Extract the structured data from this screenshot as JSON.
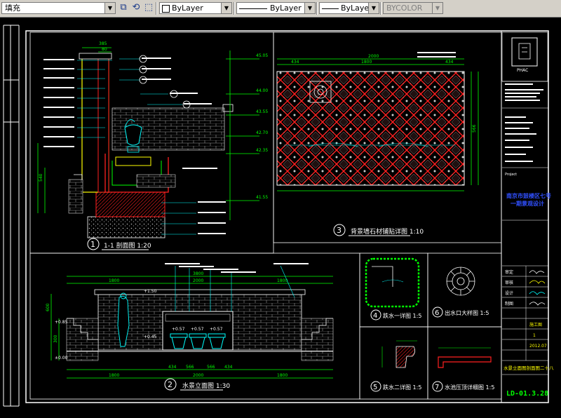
{
  "toolbar": {
    "hatch_layer": "填充",
    "color": "ByLayer",
    "linetype": "ByLayer",
    "lineweight": "ByLayer",
    "plotstyle": "BYCOLOR"
  },
  "drawing": {
    "view1_title": "1-1 剖面图 1:20",
    "view2_title": "水景立面图 1:30",
    "view3_title": "背景墙石材铺贴详图 1:10",
    "view4_title": "跌水一详图 1:5",
    "view5_title": "跌水二详图 1:5",
    "view6_title": "出水口大样图 1:5",
    "view7_title": "水池压顶详细图 1:5",
    "num1": "1",
    "num2": "2",
    "num3": "3",
    "num4": "4",
    "num5": "5",
    "num6": "6",
    "num7": "7",
    "dims": {
      "d1800a": "1800",
      "d1800b": "1800",
      "d2000": "2000",
      "d1800c": "1800",
      "d434a": "434",
      "d566a": "566",
      "d566b": "566",
      "d434b": "434",
      "d3800": "3800",
      "d1800d": "1800",
      "d2000b": "2000",
      "d1800e": "1800",
      "d434c": "434",
      "d566c": "566",
      "d566d": "566",
      "d434d": "434",
      "lv257a": "+0.57",
      "lv257b": "+0.57",
      "lv257c": "+0.57",
      "lv085": "+0.85",
      "lv045": "+0.45",
      "lv150": "+1.50",
      "lv000": "±0.00",
      "d300": "300",
      "d600": "600",
      "d150": "150",
      "d540": "540",
      "p434a": "434",
      "p1800": "1800",
      "p434b": "434",
      "p566": "566",
      "p2000": "2000",
      "e4505": "45.05",
      "e4400": "44.00",
      "e4355": "43.55",
      "e4270": "42.70",
      "e4235": "42.35",
      "e4155": "41.55",
      "d385": "385",
      "d80": "80"
    }
  },
  "titleblock": {
    "logo": "PHAC",
    "project": "南京市鼓楼区七号一期景观设计",
    "drawing_name": "水景立面图剖面图二十八",
    "sheet_no": "LD-01.3.28",
    "stage": "施工图",
    "scale": "1",
    "date": "2012.07",
    "note_header": "说明 注意事项",
    "proj_label": "Project",
    "sign_cn1": "审定",
    "sign_cn2": "审核",
    "sign_cn3": "设计",
    "sign_cn4": "制图"
  },
  "colors": {
    "frame": "#ffffff",
    "dim": "#00ff00",
    "red": "#ff2020",
    "yellow": "#ffff00",
    "cyan": "#00ffff",
    "magenta": "#ff40ff",
    "blue": "#3050ff",
    "toolbar": "#d4d0c8"
  }
}
